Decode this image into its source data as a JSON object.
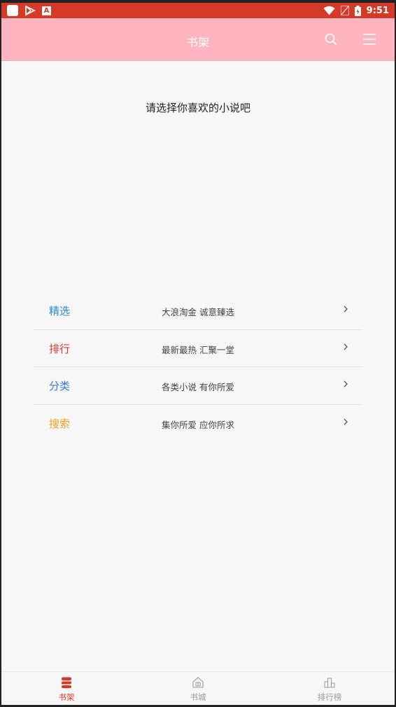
{
  "status_bar": {
    "time": "9:51",
    "left_icons": [
      "app-notification-icon",
      "play-store-icon",
      "a-icon"
    ],
    "right_icons": [
      "wifi-icon",
      "no-signal-icon",
      "battery-charging-icon"
    ]
  },
  "header": {
    "title": "书架",
    "search_icon": "search-icon",
    "menu_icon": "menu-icon"
  },
  "main": {
    "prompt": "请选择你喜欢的小说吧",
    "menu": [
      {
        "label": "精选",
        "description": "大浪淘金  诚意臻选",
        "color": "#2a8ad6"
      },
      {
        "label": "排行",
        "description": "最新最热  汇聚一堂",
        "color": "#d9342b"
      },
      {
        "label": "分类",
        "description": "各类小说  有你所爱",
        "color": "#3b78d6"
      },
      {
        "label": "搜索",
        "description": "集你所爱  应你所求",
        "color": "#f0a020"
      }
    ]
  },
  "bottom_nav": {
    "items": [
      {
        "label": "书架",
        "icon": "bookshelf-icon",
        "active": true
      },
      {
        "label": "书城",
        "icon": "bookstore-icon",
        "active": false
      },
      {
        "label": "排行榜",
        "icon": "ranking-icon",
        "active": false
      }
    ]
  },
  "colors": {
    "status_bar": "#d43a27",
    "header_bg": "#ffb5bf",
    "active_nav": "#d43a27",
    "inactive_nav": "#999999"
  }
}
